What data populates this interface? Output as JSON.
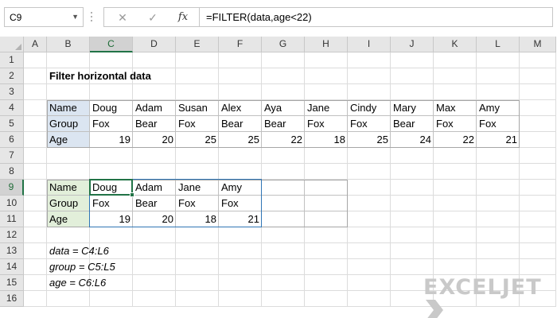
{
  "namebox": {
    "value": "C9"
  },
  "formula": {
    "text": "=FILTER(data,age<22)"
  },
  "icons": {
    "cancel": "✕",
    "enter": "✓",
    "fx": "fx",
    "dropdown": "▼"
  },
  "columns": [
    "A",
    "B",
    "C",
    "D",
    "E",
    "F",
    "G",
    "H",
    "I",
    "J",
    "K",
    "L",
    "M"
  ],
  "rows": [
    "1",
    "2",
    "3",
    "4",
    "5",
    "6",
    "7",
    "8",
    "9",
    "10",
    "11",
    "12",
    "13",
    "14",
    "15",
    "16"
  ],
  "active": {
    "column": "C",
    "row": "9"
  },
  "sheet": {
    "title": "Filter horizontal data",
    "source": {
      "labels": [
        "Name",
        "Group",
        "Age"
      ],
      "names": [
        "Doug",
        "Adam",
        "Susan",
        "Alex",
        "Aya",
        "Jane",
        "Cindy",
        "Mary",
        "Max",
        "Amy"
      ],
      "groups": [
        "Fox",
        "Bear",
        "Fox",
        "Bear",
        "Bear",
        "Fox",
        "Fox",
        "Bear",
        "Fox",
        "Fox"
      ],
      "ages": [
        "19",
        "20",
        "25",
        "25",
        "22",
        "18",
        "25",
        "24",
        "22",
        "21"
      ]
    },
    "result": {
      "labels": [
        "Name",
        "Group",
        "Age"
      ],
      "names": [
        "Doug",
        "Adam",
        "Jane",
        "Amy"
      ],
      "groups": [
        "Fox",
        "Bear",
        "Fox",
        "Fox"
      ],
      "ages": [
        "19",
        "20",
        "18",
        "21"
      ]
    },
    "named_ranges": [
      "data = C4:L6",
      "group = C5:L5",
      "age = C6:L6"
    ]
  },
  "logo": {
    "text": "EXCELJET"
  },
  "colors": {
    "accent": "#217346",
    "spill": "#2f75b5",
    "source_label_fill": "#dbe5f1",
    "result_label_fill": "#e2efda"
  }
}
